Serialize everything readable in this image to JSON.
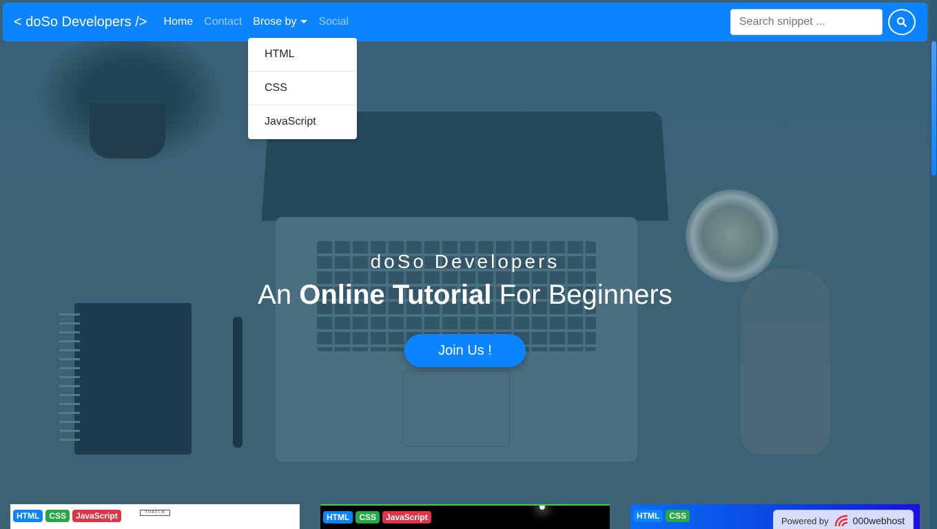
{
  "navbar": {
    "brand": "< doSo Developers />",
    "links": [
      {
        "label": "Home"
      },
      {
        "label": "Contact"
      },
      {
        "label": "Brose by"
      },
      {
        "label": "Social"
      }
    ],
    "search_placeholder": "Search snippet ...",
    "search_icon": "search-icon"
  },
  "dropdown": {
    "items": [
      "HTML",
      "CSS",
      "JavaScript"
    ]
  },
  "hero": {
    "subtitle": "doSo Developers",
    "title_prefix": "An ",
    "title_bold": "Online Tutorial",
    "title_suffix": " For Beginners",
    "button": "Join Us !"
  },
  "cards": [
    {
      "badges": [
        "HTML",
        "CSS",
        "JavaScript"
      ],
      "preview_text": "TORTCH"
    },
    {
      "badges": [
        "HTML",
        "CSS",
        "JavaScript"
      ]
    },
    {
      "badges": [
        "HTML",
        "CSS"
      ]
    }
  ],
  "powered": {
    "label": "Powered by",
    "brand": "000webhost"
  },
  "colors": {
    "primary": "#0d84ff",
    "html_badge": "#0d84ff",
    "css_badge": "#28a745",
    "js_badge": "#dc3545"
  }
}
